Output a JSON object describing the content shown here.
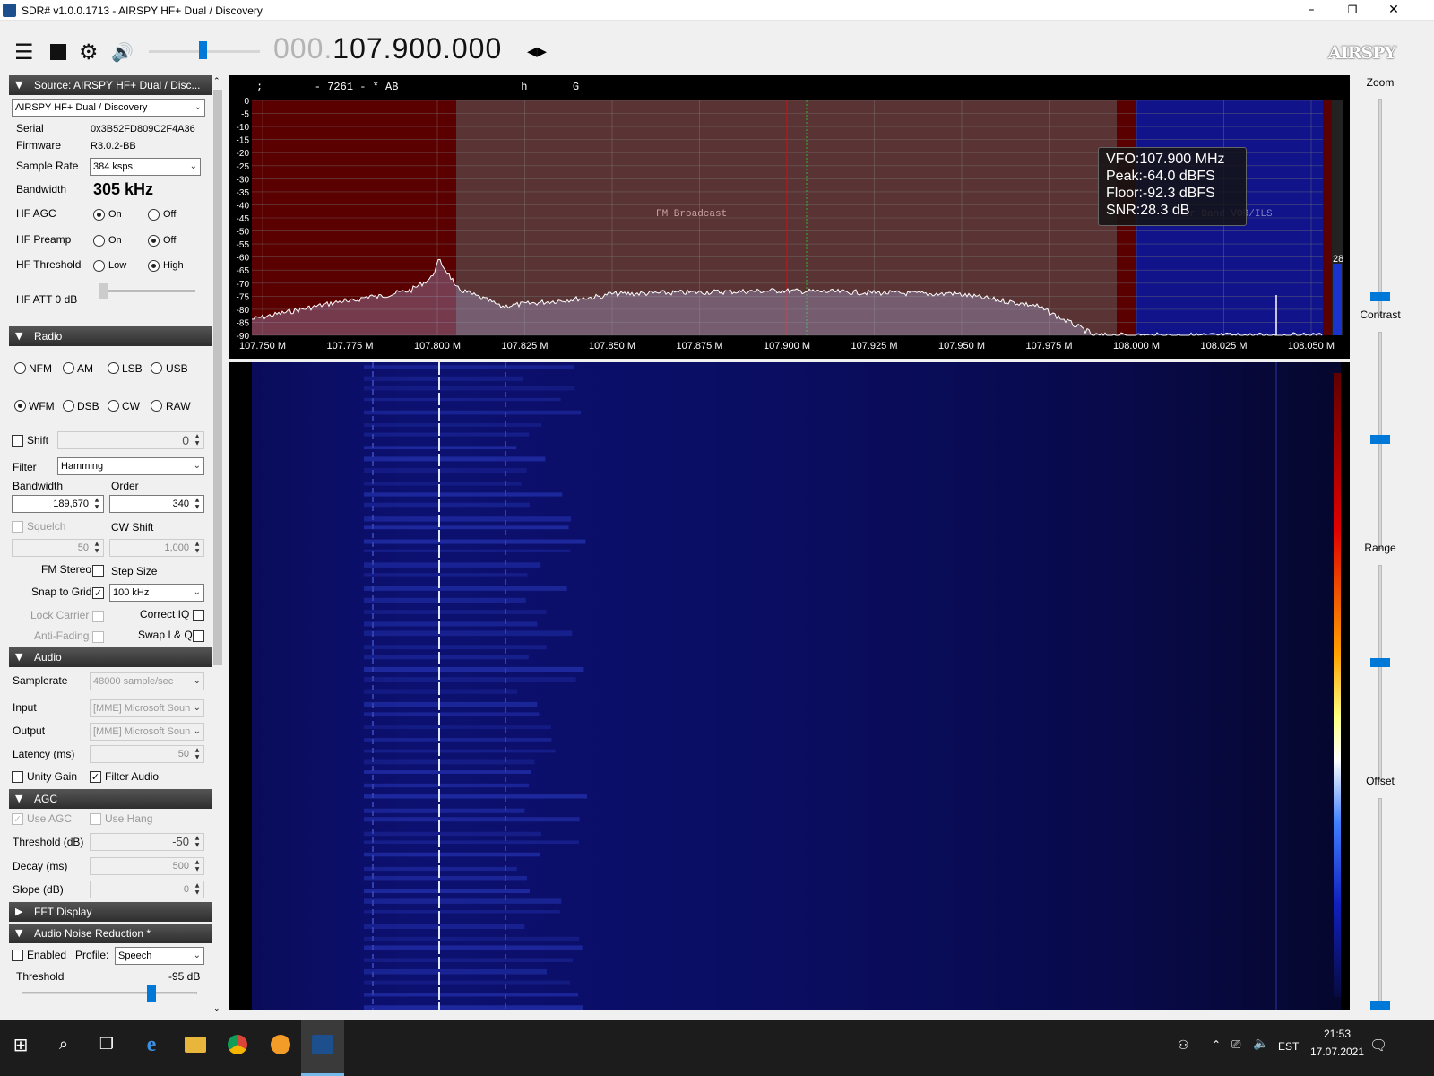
{
  "window": {
    "title": "SDR# v1.0.0.1713 - AIRSPY HF+ Dual / Discovery",
    "min": "–",
    "max": "❐",
    "close": "✕"
  },
  "toolbar": {
    "freq_dim": "000.",
    "freq_main": "107.900.000",
    "freq_arrows": "◂▸",
    "logo": "AIRSPY",
    "volume_level": 0.45
  },
  "source": {
    "header": "Source: AIRSPY HF+ Dual / Disc...",
    "device": "AIRSPY HF+ Dual / Discovery",
    "serial_label": "Serial",
    "serial": "0x3B52FD809C2F4A36",
    "firmware_label": "Firmware",
    "firmware": "R3.0.2-BB",
    "samplerate_label": "Sample Rate",
    "samplerate": "384 ksps",
    "bandwidth_label": "Bandwidth",
    "bandwidth": "305 kHz",
    "agc_label": "HF AGC",
    "preamp_label": "HF Preamp",
    "threshold_label": "HF Threshold",
    "on": "On",
    "off": "Off",
    "low": "Low",
    "high": "High",
    "att_label": "HF ATT 0 dB"
  },
  "radio": {
    "header": "Radio",
    "modes": [
      "NFM",
      "AM",
      "LSB",
      "USB",
      "WFM",
      "DSB",
      "CW",
      "RAW"
    ],
    "selected_mode": "WFM",
    "shift_label": "Shift",
    "shift_value": "0",
    "filter_label": "Filter",
    "filter_value": "Hamming",
    "bandwidth_label": "Bandwidth",
    "bandwidth_value": "189,670",
    "order_label": "Order",
    "order_value": "340",
    "squelch_label": "Squelch",
    "squelch_value": "50",
    "cwshift_label": "CW Shift",
    "cwshift_value": "1,000",
    "fmstereo_label": "FM Stereo",
    "stepsize_label": "Step Size",
    "snap_label": "Snap to Grid",
    "snap_value": "100 kHz",
    "lockcarrier_label": "Lock Carrier",
    "correctiq_label": "Correct IQ",
    "antifading_label": "Anti-Fading",
    "swapiq_label": "Swap I & Q"
  },
  "audio": {
    "header": "Audio",
    "samplerate_label": "Samplerate",
    "samplerate_value": "48000 sample/sec",
    "input_label": "Input",
    "input_value": "[MME] Microsoft Soun",
    "output_label": "Output",
    "output_value": "[MME] Microsoft Soun",
    "latency_label": "Latency (ms)",
    "latency_value": "50",
    "unity_label": "Unity Gain",
    "filter_label": "Filter Audio"
  },
  "agc": {
    "header": "AGC",
    "use_agc": "Use AGC",
    "use_hang": "Use Hang",
    "threshold_label": "Threshold (dB)",
    "threshold_value": "-50",
    "decay_label": "Decay (ms)",
    "decay_value": "500",
    "slope_label": "Slope (dB)",
    "slope_value": "0"
  },
  "fft": {
    "header": "FFT Display"
  },
  "anr": {
    "header": "Audio Noise Reduction *",
    "enabled_label": "Enabled",
    "profile_label": "Profile:",
    "profile_value": "Speech",
    "threshold_label": "Threshold",
    "threshold_value": "-95 dB"
  },
  "spectrum": {
    "rds_line": ";        - 7261 - * AB                   h       G",
    "db_labels": [
      "0",
      "-5",
      "-10",
      "-15",
      "-20",
      "-25",
      "-30",
      "-35",
      "-40",
      "-45",
      "-50",
      "-55",
      "-60",
      "-65",
      "-70",
      "-75",
      "-80",
      "-85",
      "-90"
    ],
    "freq_labels": [
      "107.750 M",
      "107.775 M",
      "107.800 M",
      "107.825 M",
      "107.850 M",
      "107.875 M",
      "107.900 M",
      "107.925 M",
      "107.950 M",
      "107.975 M",
      "108.000 M",
      "108.025 M",
      "108.050 M"
    ],
    "band_fm": "FM Broadcast",
    "band_air": "Air Band VOR/ILS",
    "vfo": "VFO:107.900 MHz",
    "peak": "Peak:-64.0 dBFS",
    "floor": "Floor:-92.3 dBFS",
    "snr": "SNR:28.3 dB",
    "snr_bar": "28"
  },
  "right": {
    "zoom": "Zoom",
    "contrast": "Contrast",
    "range": "Range",
    "offset": "Offset"
  },
  "taskbar": {
    "lang": "EST",
    "time": "21:53",
    "date": "17.07.2021"
  }
}
